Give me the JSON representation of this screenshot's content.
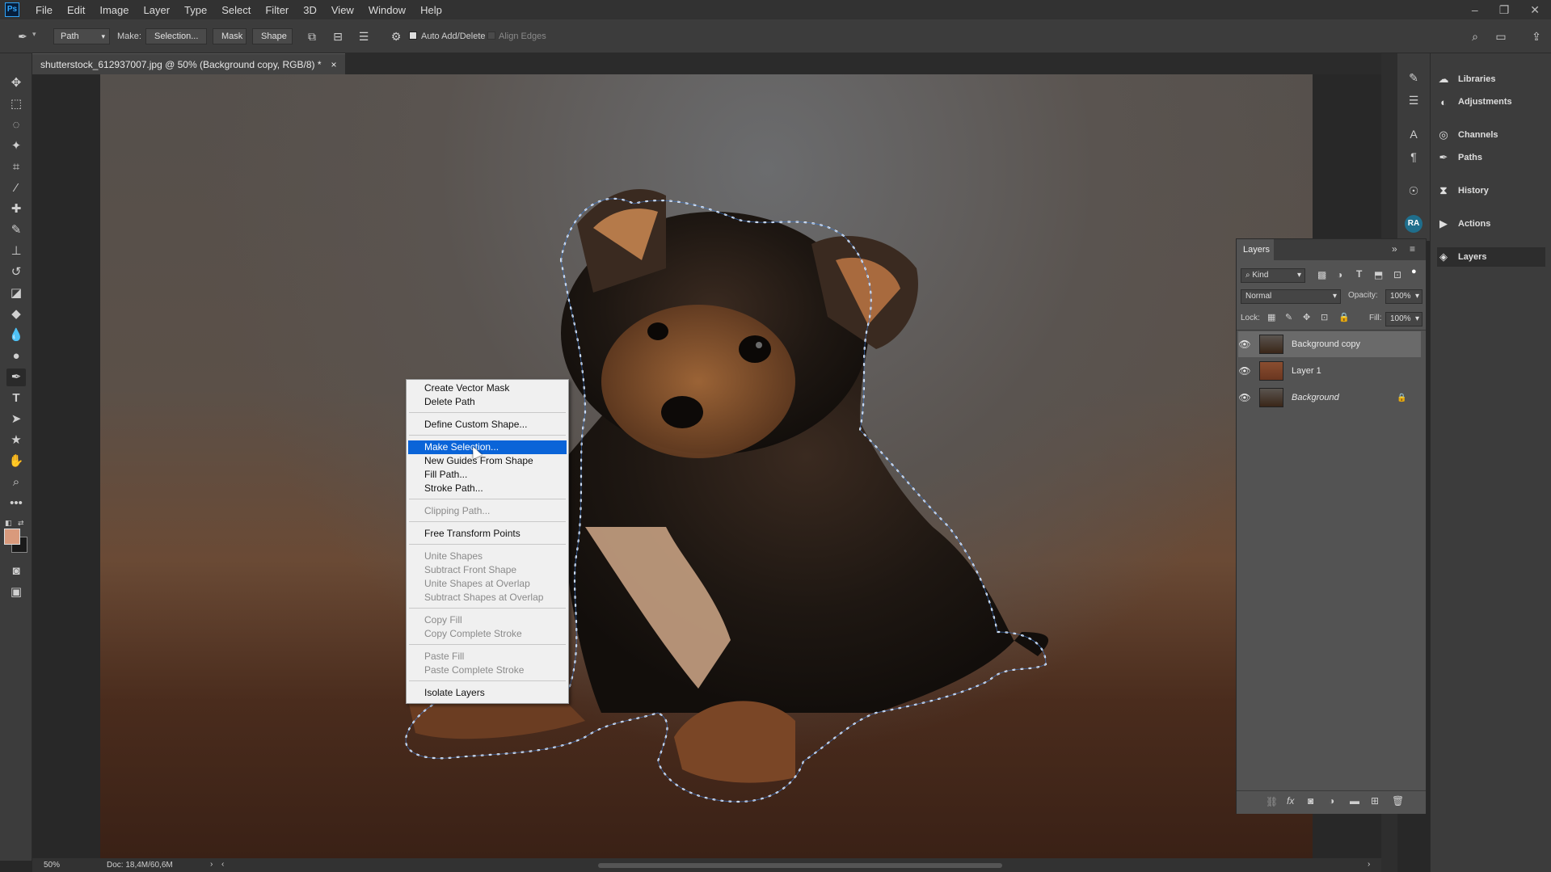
{
  "app": {
    "logo": "Ps"
  },
  "menubar": {
    "items": [
      "File",
      "Edit",
      "Image",
      "Layer",
      "Type",
      "Select",
      "Filter",
      "3D",
      "View",
      "Window",
      "Help"
    ],
    "window_controls": [
      "minimize-icon",
      "restore-icon",
      "close-icon"
    ]
  },
  "options": {
    "mode": "Path",
    "make_label": "Make:",
    "selection_btn": "Selection...",
    "mask_btn": "Mask",
    "shape_btn": "Shape",
    "auto_add_delete": "Auto Add/Delete",
    "auto_add_delete_checked": true,
    "align_edges": "Align Edges",
    "align_edges_checked": false
  },
  "document": {
    "tab_title": "shutterstock_612937007.jpg @ 50% (Background copy, RGB/8) *",
    "close": "×"
  },
  "status": {
    "zoom": "50%",
    "doc": "Doc: 18,4M/60,6M"
  },
  "side_panels": {
    "items": [
      "Libraries",
      "Adjustments",
      "Channels",
      "Paths",
      "History",
      "Actions",
      "Layers"
    ],
    "avatar": "RA"
  },
  "layers_panel": {
    "title": "Layers",
    "filter": "Kind",
    "blend_mode": "Normal",
    "opacity_label": "Opacity:",
    "opacity": "100%",
    "lock_label": "Lock:",
    "fill_label": "Fill:",
    "fill": "100%",
    "layers": [
      {
        "name": "Background copy",
        "selected": true,
        "italic": false,
        "locked": false
      },
      {
        "name": "Layer 1",
        "selected": false,
        "italic": false,
        "locked": false
      },
      {
        "name": "Background",
        "selected": false,
        "italic": true,
        "locked": true
      }
    ]
  },
  "context_menu": {
    "items": [
      {
        "label": "Create Vector Mask",
        "enabled": true
      },
      {
        "label": "Delete Path",
        "enabled": true
      },
      {
        "label": "Define Custom Shape...",
        "enabled": true
      },
      {
        "label": "Make Selection...",
        "enabled": true,
        "highlighted": true
      },
      {
        "label": "New Guides From Shape",
        "enabled": true
      },
      {
        "label": "Fill Path...",
        "enabled": true
      },
      {
        "label": "Stroke Path...",
        "enabled": true
      },
      {
        "label": "Clipping Path...",
        "enabled": false
      },
      {
        "label": "Free Transform Points",
        "enabled": true
      },
      {
        "label": "Unite Shapes",
        "enabled": false
      },
      {
        "label": "Subtract Front Shape",
        "enabled": false
      },
      {
        "label": "Unite Shapes at Overlap",
        "enabled": false
      },
      {
        "label": "Subtract Shapes at Overlap",
        "enabled": false
      },
      {
        "label": "Copy Fill",
        "enabled": false
      },
      {
        "label": "Copy Complete Stroke",
        "enabled": false
      },
      {
        "label": "Paste Fill",
        "enabled": false
      },
      {
        "label": "Paste Complete Stroke",
        "enabled": false
      },
      {
        "label": "Isolate Layers",
        "enabled": true
      }
    ]
  },
  "colors": {
    "highlight": "#0a64d8",
    "path": "#ffffff",
    "foreground": "#d99a7c",
    "background": "#1a1a1a"
  }
}
